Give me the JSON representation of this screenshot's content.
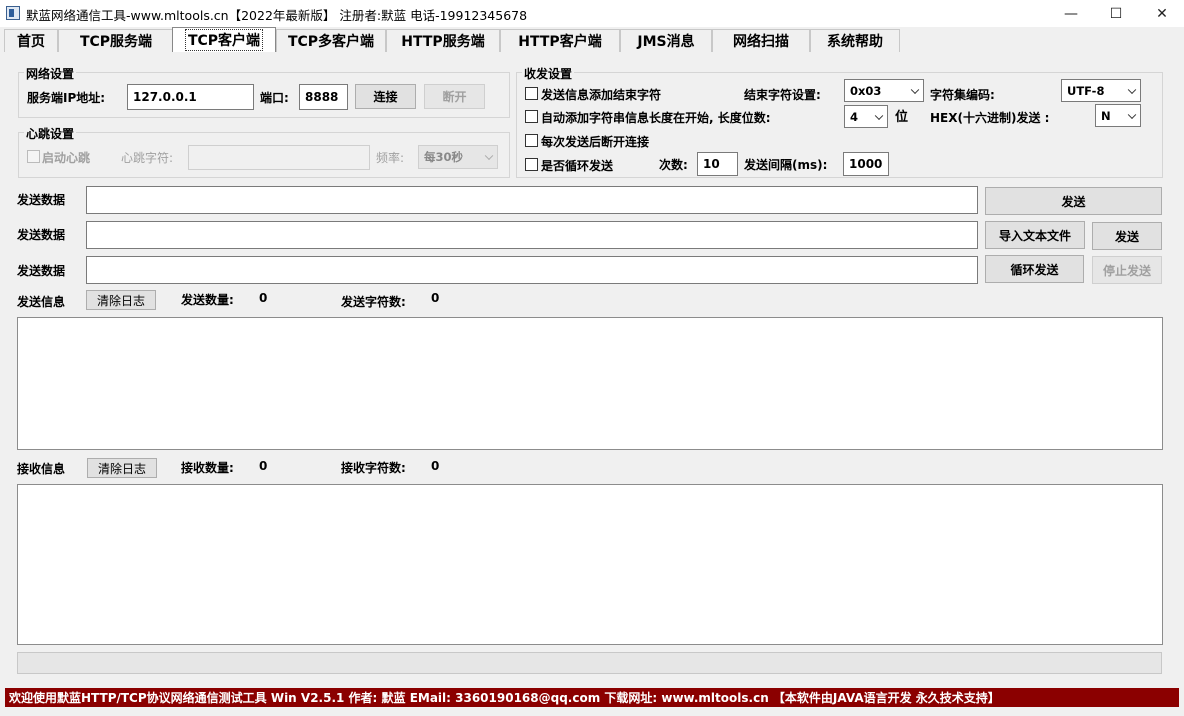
{
  "window": {
    "title": "默蓝网络通信工具-www.mltools.cn【2022年最新版】 注册者:默蓝 电话-19912345678",
    "minimize": "—",
    "maximize": "☐",
    "close": "✕"
  },
  "tabs": [
    "首页",
    "TCP服务端",
    "TCP客户端",
    "TCP多客户端",
    "HTTP服务端",
    "HTTP客户端",
    "JMS消息",
    "网络扫描",
    "系统帮助"
  ],
  "network": {
    "group_title": "网络设置",
    "ip_label": "服务端IP地址:",
    "ip_value": "127.0.0.1",
    "port_label": "端口:",
    "port_value": "8888",
    "connect_button": "连接",
    "disconnect_button": "断开"
  },
  "heartbeat": {
    "group_title": "心跳设置",
    "enable_label": "启动心跳",
    "char_label": "心跳字符:",
    "char_value": "",
    "freq_label": "频率:",
    "freq_value": "每30秒"
  },
  "sendrecv": {
    "group_title": "收发设置",
    "add_end_char": "发送信息添加结束字符",
    "end_char_label": "结束字符设置:",
    "end_char_value": "0x03",
    "charset_label": "字符集编码:",
    "charset_value": "UTF-8",
    "auto_len": "自动添加字符串信息长度在开始, 长度位数:",
    "len_digits_value": "4",
    "len_unit": "位",
    "hex_label": "HEX(十六进制)发送 :",
    "hex_value": "N",
    "disconnect_after": "每次发送后断开连接",
    "loop_send": "是否循环发送",
    "count_label": "次数:",
    "count_value": "10",
    "interval_label": "发送间隔(ms):",
    "interval_value": "1000"
  },
  "send_rows": {
    "label1": "发送数据",
    "label2": "发送数据",
    "label3": "发送数据",
    "value1": "",
    "value2": "",
    "value3": "",
    "send_button": "发送",
    "import_button": "导入文本文件",
    "send_button2": "发送",
    "loop_button": "循环发送",
    "stop_button": "停止发送"
  },
  "send_log": {
    "label": "发送信息",
    "clear_button": "清除日志",
    "count_label": "发送数量:",
    "count_value": "0",
    "chars_label": "发送字符数:",
    "chars_value": "0"
  },
  "recv_log": {
    "label": "接收信息",
    "clear_button": "清除日志",
    "count_label": "接收数量:",
    "count_value": "0",
    "chars_label": "接收字符数:",
    "chars_value": "0"
  },
  "status": {
    "text": "欢迎使用默蓝HTTP/TCP协议网络通信测试工具 Win V2.5.1  作者: 默蓝  EMail: 3360190168@qq.com  下载网址: www.mltools.cn  【本软件由JAVA语言开发  永久技术支持】"
  },
  "colors": {
    "status_bg": "#8b0000",
    "window_bg": "#f0f0f0"
  }
}
